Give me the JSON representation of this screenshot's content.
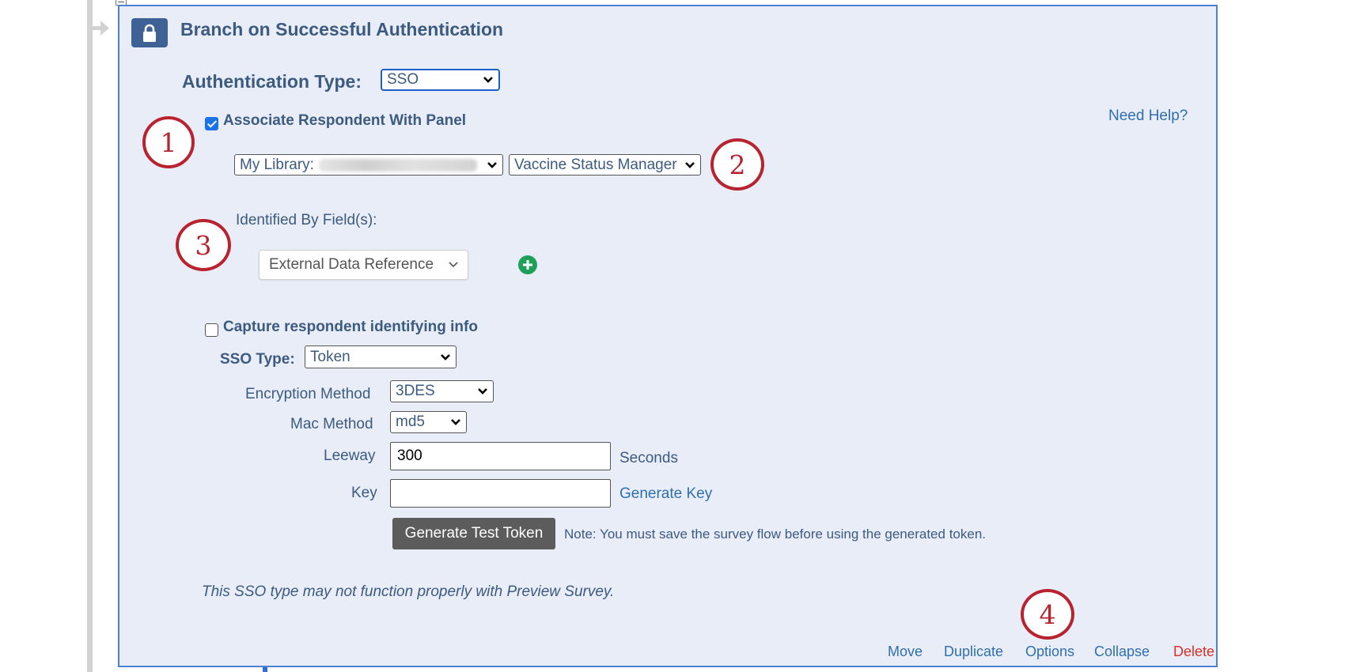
{
  "header": {
    "title": "Branch on Successful Authentication"
  },
  "auth": {
    "type_label": "Authentication Type:",
    "type_value": "SSO"
  },
  "help": {
    "label": "Need Help?"
  },
  "associate": {
    "checked": true,
    "label": "Associate Respondent With Panel",
    "library_prefix": "My Library:",
    "panel_value": "Vaccine Status Manager"
  },
  "identified": {
    "label": "Identified By Field(s):",
    "field_value": "External Data Reference"
  },
  "capture": {
    "checked": false,
    "label": "Capture respondent identifying info"
  },
  "sso": {
    "type_label": "SSO Type:",
    "type_value": "Token",
    "encryption_label": "Encryption Method",
    "encryption_value": "3DES",
    "mac_label": "Mac Method",
    "mac_value": "md5",
    "leeway_label": "Leeway",
    "leeway_value": "300",
    "leeway_unit": "Seconds",
    "key_label": "Key",
    "key_value": "",
    "generate_key_label": "Generate Key",
    "generate_token_label": "Generate Test Token",
    "note": "Note: You must save the survey flow before using the generated token."
  },
  "warning": "This SSO type may not function properly with Preview Survey.",
  "footer": {
    "move": "Move",
    "duplicate": "Duplicate",
    "options": "Options",
    "collapse": "Collapse",
    "delete": "Delete"
  },
  "callouts": [
    "1",
    "2",
    "3",
    "4"
  ],
  "colors": {
    "panel_bg": "#e8edf7",
    "panel_border": "#4b82d6",
    "heading": "#3d5a80",
    "link": "#2f6fb0",
    "delete": "#d93025",
    "callout": "#b8232f",
    "add_button": "#1ea05a",
    "lock_badge": "#3f6296"
  },
  "icons": {
    "lock": "lock-icon",
    "add": "plus-circle-icon",
    "chevron": "chevron-down-icon",
    "flow_arrow": "arrow-right-icon"
  }
}
